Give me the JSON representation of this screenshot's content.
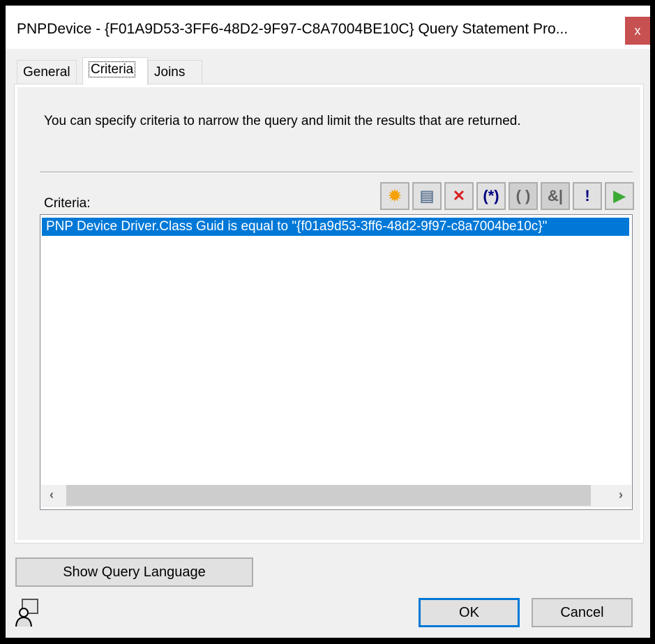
{
  "window": {
    "title": "PNPDevice - {F01A9D53-3FF6-48D2-9F97-C8A7004BE10C} Query Statement Pro...",
    "close_label": "x"
  },
  "tabs": [
    {
      "label": "General"
    },
    {
      "label": "Criteria"
    },
    {
      "label": "Joins"
    }
  ],
  "criteria_tab": {
    "description": "You can specify criteria to narrow the query and limit the results that are returned.",
    "list_label": "Criteria:",
    "toolbar": [
      {
        "icon": "new-criterion-icon",
        "glyph": "✹",
        "color": "#f5a000"
      },
      {
        "icon": "properties-icon",
        "glyph": "▤",
        "color": "#6a7f9a"
      },
      {
        "icon": "delete-icon",
        "glyph": "✕",
        "color": "#d92020"
      },
      {
        "icon": "add-clause-icon",
        "glyph": "(*)",
        "color": "#000080"
      },
      {
        "icon": "remove-clause-icon",
        "glyph": "( )",
        "color": "#606060"
      },
      {
        "icon": "and-or-icon",
        "glyph": "&|",
        "color": "#606060"
      },
      {
        "icon": "not-icon",
        "glyph": "!",
        "color": "#000080"
      },
      {
        "icon": "run-icon",
        "glyph": "▶",
        "color": "#3aaa35"
      }
    ],
    "items": [
      "PNP Device Driver.Class Guid is equal to \"{f01a9d53-3ff6-48d2-9f97-c8a7004be10c}\""
    ],
    "scroll_left": "‹",
    "scroll_right": "›"
  },
  "buttons": {
    "show_query": "Show Query Language",
    "ok": "OK",
    "cancel": "Cancel"
  }
}
